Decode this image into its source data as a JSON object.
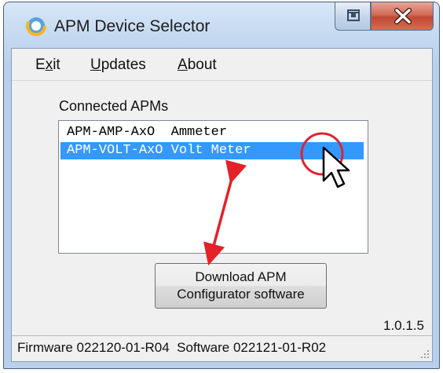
{
  "window": {
    "title": "APM Device Selector"
  },
  "menu": {
    "exit_prefix": "E",
    "exit_ul": "x",
    "exit_suffix": "it",
    "updates_ul": "U",
    "updates_suffix": "pdates",
    "about_ul": "A",
    "about_suffix": "bout"
  },
  "main": {
    "group_label": "Connected APMs",
    "devices": [
      {
        "label": "APM-AMP-AxO  Ammeter",
        "selected": false
      },
      {
        "label": "APM-VOLT-AxO Volt Meter",
        "selected": true
      }
    ],
    "download_line1": "Download APM",
    "download_line2": "Configurator software",
    "version": "1.0.1.5"
  },
  "status": {
    "text": "Firmware 022120-01-R04  Software 022121-01-R02"
  },
  "colors": {
    "selection": "#3399ff",
    "annotation": "#e3222a"
  },
  "icons": {
    "app": "app-ring-icon",
    "restore": "restore-icon",
    "close": "close-icon",
    "cursor": "mouse-pointer-icon",
    "grip": "resize-grip-icon"
  }
}
